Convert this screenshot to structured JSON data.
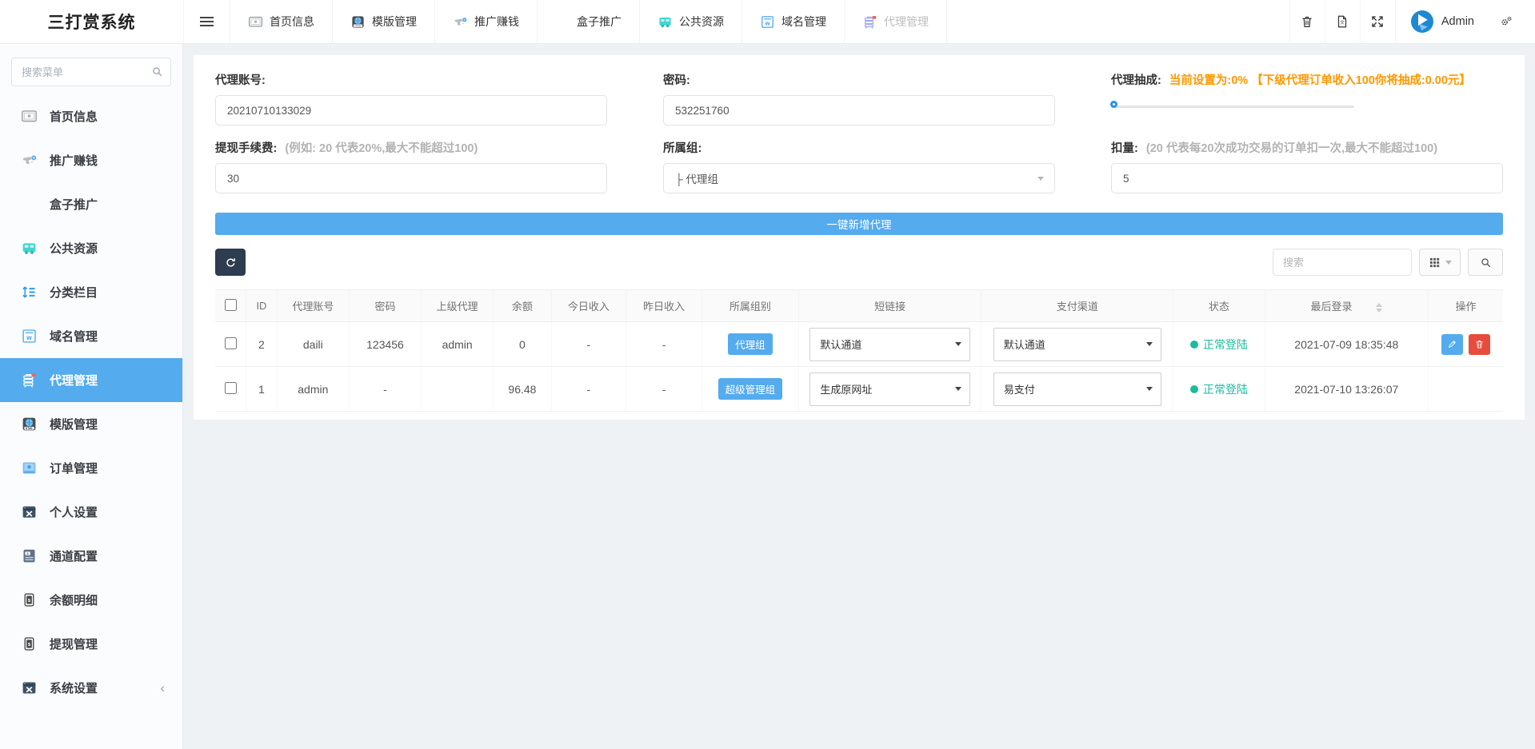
{
  "app": {
    "title": "三打赏系统",
    "user": "Admin"
  },
  "topnav": {
    "tabs": [
      {
        "label": "首页信息",
        "icon": "image-icon"
      },
      {
        "label": "模版管理",
        "icon": "template-icon"
      },
      {
        "label": "推广赚钱",
        "icon": "spray-gun-icon"
      },
      {
        "label": "盒子推广",
        "icon": "box-icon"
      },
      {
        "label": "公共资源",
        "icon": "bus-icon"
      },
      {
        "label": "域名管理",
        "icon": "domain-icon"
      },
      {
        "label": "代理管理",
        "icon": "agent-rack-icon"
      }
    ]
  },
  "sidebar": {
    "search_placeholder": "搜索菜单",
    "collapse_arrow": "‹",
    "items": [
      {
        "label": "首页信息",
        "icon": "image-icon"
      },
      {
        "label": "推广赚钱",
        "icon": "spray-gun-icon"
      },
      {
        "label": "盒子推广",
        "icon": "box-icon"
      },
      {
        "label": "公共资源",
        "icon": "bus-icon"
      },
      {
        "label": "分类栏目",
        "icon": "sort-lines-icon"
      },
      {
        "label": "域名管理",
        "icon": "domain-icon"
      },
      {
        "label": "代理管理",
        "icon": "agent-rack-icon"
      },
      {
        "label": "模版管理",
        "icon": "template-icon"
      },
      {
        "label": "订单管理",
        "icon": "order-icon"
      },
      {
        "label": "个人设置",
        "icon": "tools-window-icon"
      },
      {
        "label": "通道配置",
        "icon": "channel-doc-icon"
      },
      {
        "label": "余额明细",
        "icon": "wallet-icon"
      },
      {
        "label": "提现管理",
        "icon": "wallet-icon"
      },
      {
        "label": "系统设置",
        "icon": "tools-window-icon"
      }
    ]
  },
  "form": {
    "agent_account": {
      "label": "代理账号:",
      "value": "20210710133029"
    },
    "password": {
      "label": "密码:",
      "value": "532251760"
    },
    "commission": {
      "label": "代理抽成:",
      "status": "当前设置为:0% 【下级代理订单收入100你将抽成:0.00元】",
      "percent": "0"
    },
    "withdraw_fee": {
      "label": "提现手续费:",
      "hint": "(例如: 20 代表20%,最大不能超过100)",
      "value": "30"
    },
    "group": {
      "label": "所属组:",
      "value": "├ 代理组"
    },
    "deduction": {
      "label": "扣量:",
      "hint": "(20 代表每20次成功交易的订单扣一次,最大不能超过100)",
      "value": "5"
    },
    "submit_label": "一键新增代理"
  },
  "toolbar": {
    "search_placeholder": "搜索"
  },
  "table": {
    "columns": {
      "id": "ID",
      "account": "代理账号",
      "password": "密码",
      "parent": "上级代理",
      "balance": "余额",
      "today": "今日收入",
      "yesterday": "昨日收入",
      "group": "所属组别",
      "shortlink": "短链接",
      "pay": "支付渠道",
      "status": "状态",
      "last_login": "最后登录",
      "actions": "操作"
    },
    "rows": [
      {
        "id": "2",
        "account": "daili",
        "password": "123456",
        "parent": "admin",
        "balance": "0",
        "today": "-",
        "yesterday": "-",
        "group": "代理组",
        "shortlink": "默认通道",
        "pay": "默认通道",
        "status": "正常登陆",
        "last_login": "2021-07-09 18:35:48"
      },
      {
        "id": "1",
        "account": "admin",
        "password": "-",
        "parent": "",
        "balance": "96.48",
        "today": "-",
        "yesterday": "-",
        "group": "超级管理组",
        "shortlink": "生成原网址",
        "pay": "易支付",
        "status": "正常登陆",
        "last_login": "2021-07-10 13:26:07"
      }
    ]
  },
  "colors": {
    "primary": "#54abee",
    "orange": "#ff9800",
    "green": "#1abc9c",
    "red": "#e74c3c",
    "navy": "#2d3c4e"
  }
}
